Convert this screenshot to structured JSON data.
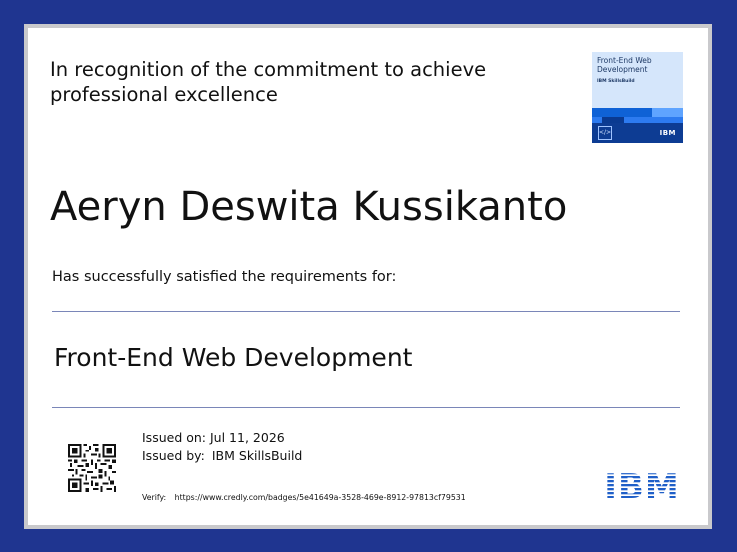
{
  "recognition": {
    "line1": "In recognition of the commitment to achieve",
    "line2": "professional excellence"
  },
  "badge": {
    "title_line1": "Front-End Web",
    "title_line2": "Development",
    "provider": "IBM SkillsBuild",
    "brand": "IBM",
    "icon": "code-icon"
  },
  "recipient": {
    "name": "Aeryn Deswita Kussikanto"
  },
  "requirement_text": "Has successfully satisfied the requirements for:",
  "course": {
    "title": "Front-End Web Development"
  },
  "issue": {
    "issued_on_label": "Issued on:",
    "issued_on_value": "Jul 11, 2026",
    "issued_by_label": "Issued by:",
    "issued_by_value": "IBM SkillsBuild"
  },
  "verify": {
    "label": "Verify:",
    "url": "https://www.credly.com/badges/5e41649a-3528-469e-8912-97813cf79531"
  },
  "logo": {
    "icon": "ibm-logo",
    "color": "#1f5fc8"
  },
  "colors": {
    "border": "#1f3590",
    "rule": "#7a86b8"
  }
}
